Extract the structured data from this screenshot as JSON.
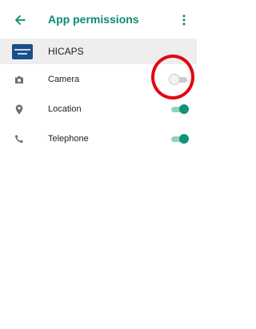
{
  "header": {
    "title": "App permissions",
    "back_icon": "arrow-back-icon",
    "overflow_icon": "more-vert-icon",
    "accent_color": "#0e8a70"
  },
  "app": {
    "name": "HICAPS",
    "icon": "hicaps-app-icon"
  },
  "permissions": [
    {
      "label": "Camera",
      "icon": "camera-icon",
      "enabled": false
    },
    {
      "label": "Location",
      "icon": "location-pin-icon",
      "enabled": true
    },
    {
      "label": "Telephone",
      "icon": "phone-icon",
      "enabled": true
    }
  ],
  "annotation": {
    "shape": "red-circle",
    "color": "#e30613",
    "target": "Camera toggle"
  }
}
